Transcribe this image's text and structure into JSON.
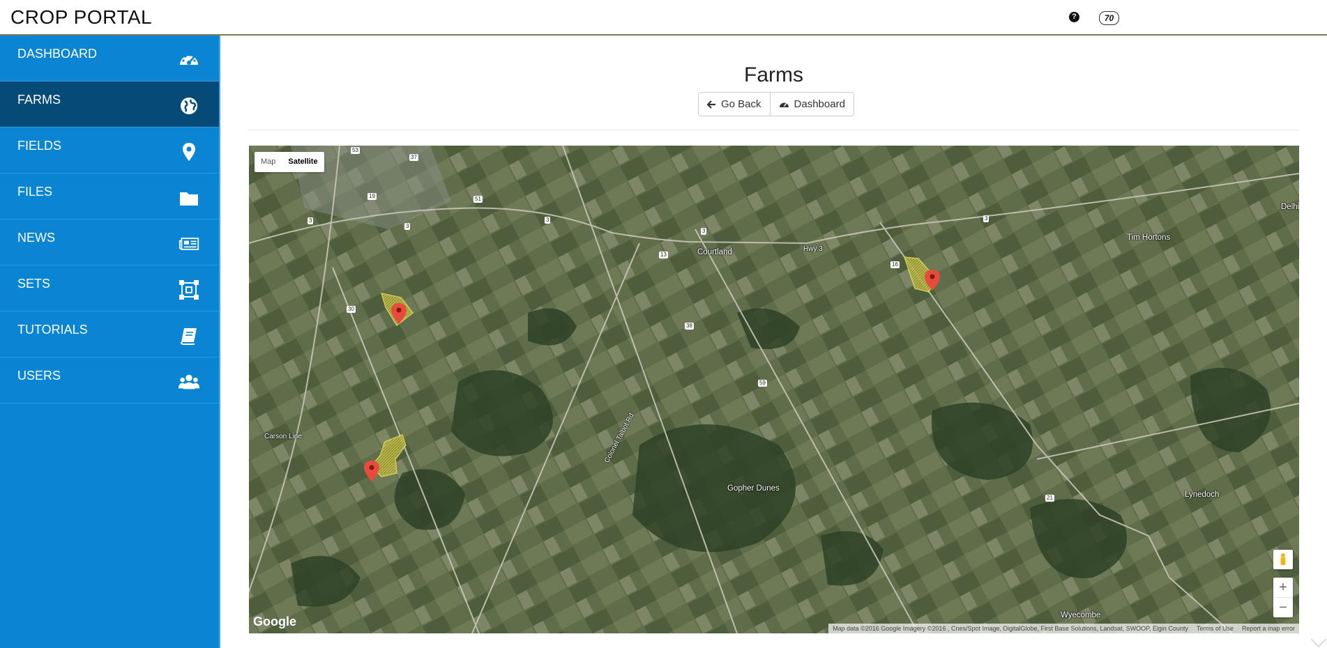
{
  "app": {
    "title": "CROP PORTAL",
    "help_icon": "question-circle-icon",
    "badge": "70"
  },
  "sidebar": {
    "items": [
      {
        "label": "DASHBOARD",
        "icon": "dashboard-gauge-icon"
      },
      {
        "label": "FARMS",
        "icon": "globe-icon",
        "active": true
      },
      {
        "label": "FIELDS",
        "icon": "map-pin-icon"
      },
      {
        "label": "FILES",
        "icon": "folder-icon"
      },
      {
        "label": "NEWS",
        "icon": "newspaper-icon"
      },
      {
        "label": "SETS",
        "icon": "vector-square-icon"
      },
      {
        "label": "TUTORIALS",
        "icon": "book-icon"
      },
      {
        "label": "USERS",
        "icon": "users-icon"
      }
    ]
  },
  "page": {
    "title": "Farms",
    "go_back": "Go Back",
    "dashboard": "Dashboard"
  },
  "map": {
    "type_map": "Map",
    "type_satellite": "Satellite",
    "places": {
      "courtland": "Courtland",
      "gopher": "Gopher Dunes",
      "tim": "Tim Hortons",
      "lynedoch": "Lynedoch",
      "wyecombe": "Wyecombe",
      "delhi": "Delhi",
      "carson": "Carson Line",
      "colonel": "Colonel Talbot Rd",
      "hwy3": "Hwy 3"
    },
    "road_numbers": [
      "3",
      "51",
      "19",
      "37",
      "53",
      "30",
      "38",
      "59",
      "13",
      "16",
      "21",
      "3",
      "3",
      "3",
      "3"
    ],
    "zoom_in": "+",
    "zoom_out": "−",
    "google": "Google",
    "attribution": "Map data ©2016 Google Imagery ©2016 , Cnes/Spot Image, DigitalGlobe, First Base Solutions, Landsat, SWOOP, Elgin County",
    "terms": "Terms of Use",
    "report": "Report a map error"
  }
}
